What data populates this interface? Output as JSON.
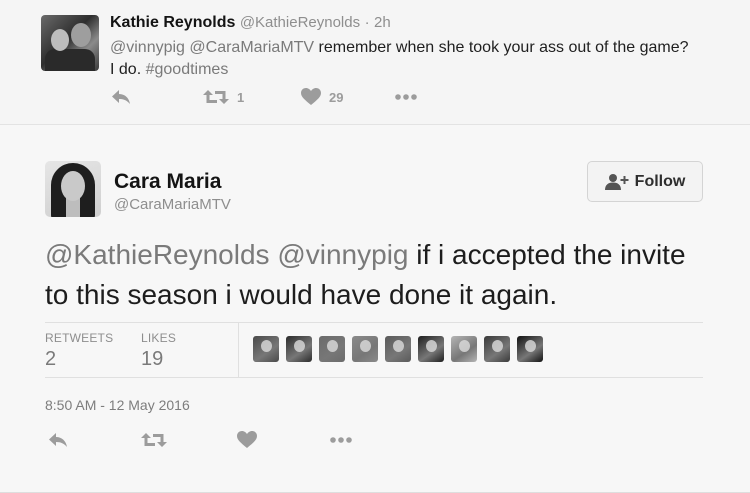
{
  "reply": {
    "name": "Kathie Reynolds",
    "handle": "@KathieReynolds",
    "separator": "·",
    "time": "2h",
    "mentions": "@vinnypig @CaraMariaMTV",
    "text_1": "remember when she took your ass out of the game?",
    "text_2": "I do.",
    "hashtag": "#goodtimes",
    "retweets": "1",
    "likes": "29"
  },
  "tweet": {
    "name": "Cara Maria",
    "handle": "@CaraMariaMTV",
    "follow_label": "Follow",
    "mentions": "@KathieReynolds @vinnypig",
    "text": "if i accepted the invite to this season i would have done it again.",
    "retweets_label": "RETWEETS",
    "retweets": "2",
    "likes_label": "LIKES",
    "likes": "19",
    "timestamp": "8:50 AM - 12 May 2016"
  },
  "likers": [
    {
      "name": "liker-1",
      "color": "#4a4a4a"
    },
    {
      "name": "liker-2",
      "color": "#2b2b2b"
    },
    {
      "name": "liker-3",
      "color": "#6b6b6b"
    },
    {
      "name": "liker-4",
      "color": "#8a8a8a"
    },
    {
      "name": "liker-5",
      "color": "#5a5a5a"
    },
    {
      "name": "liker-6",
      "color": "#1e1e1e"
    },
    {
      "name": "liker-7",
      "color": "#b5b5b5"
    },
    {
      "name": "liker-8",
      "color": "#3a3a3a"
    },
    {
      "name": "liker-9",
      "color": "#111111"
    }
  ],
  "colors": {
    "mention": "#7a7a7a",
    "icon": "#9c9c9c",
    "text": "#1d1d1d"
  },
  "icons": [
    "reply-icon",
    "retweet-icon",
    "heart-icon",
    "more-icon",
    "follow-person-icon"
  ]
}
